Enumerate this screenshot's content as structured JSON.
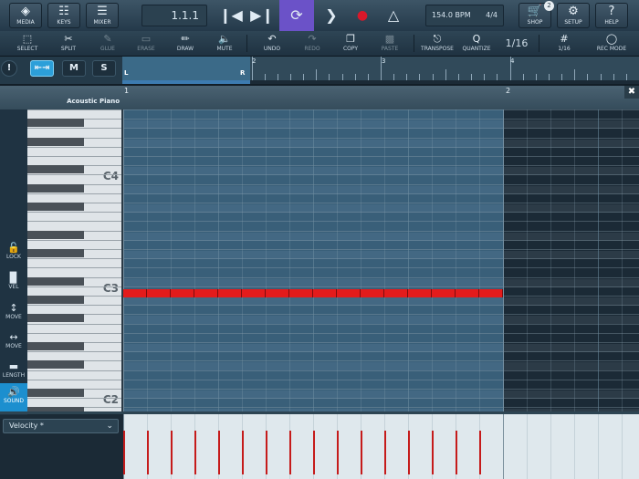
{
  "top": {
    "media": "MEDIA",
    "keys": "KEYS",
    "mixer": "MIXER",
    "position": "1.1.1",
    "tempo": "154.0 BPM",
    "signature": "4/4",
    "shop": "SHOP",
    "shop_badge": "2",
    "setup": "SETUP",
    "help": "HELP"
  },
  "tools": {
    "select": "SELECT",
    "split": "SPLIT",
    "glue": "GLUE",
    "erase": "ERASE",
    "draw": "DRAW",
    "mute": "MUTE",
    "undo": "UNDO",
    "redo": "REDO",
    "copy": "COPY",
    "paste": "PASTE",
    "transpose": "TRANSPOSE",
    "quantize": "QUANTIZE",
    "quantize_value": "1/16",
    "grid": "1/16",
    "rec_mode": "REC MODE"
  },
  "ruler": {
    "m_label": "M",
    "s_label": "S",
    "bars": [
      "1",
      "2",
      "3",
      "4"
    ],
    "locator_left": "L",
    "locator_right": "R"
  },
  "track": {
    "name": "Acoustic Piano",
    "bar1": "1",
    "bar2": "2"
  },
  "left_tools": {
    "lock": "LOCK",
    "vel": "VEL",
    "move_v": "MOVE",
    "move_h": "MOVE",
    "length": "LENGTH",
    "sound": "SOUND"
  },
  "keyboard": {
    "c4": "C4",
    "c3": "C3",
    "c2": "C2"
  },
  "velocity": {
    "select_label": "Velocity *",
    "bar_count": 16
  },
  "colors": {
    "note": "#e31b1b",
    "accent": "#6b52c8",
    "record": "#d8182a"
  }
}
